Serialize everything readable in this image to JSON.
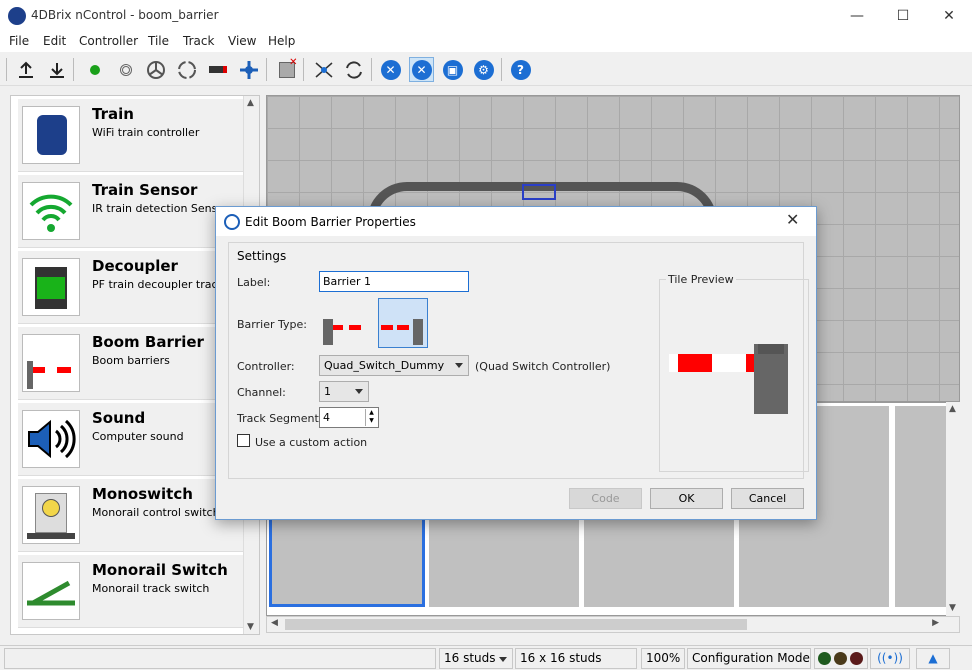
{
  "window": {
    "title": "4DBrix nControl - boom_barrier",
    "minimize": "—",
    "maximize": "☐",
    "close": "✕"
  },
  "menu": [
    "File",
    "Edit",
    "Controller",
    "Tile",
    "Track",
    "View",
    "Help"
  ],
  "toolbar": {
    "icons": [
      "upload-icon",
      "download-icon",
      "green-dot-icon",
      "sensor-icon",
      "switch-icon",
      "loop-icon",
      "decoupler-icon",
      "cross-icon",
      "delete-icon",
      "network-icon",
      "refresh-icon",
      "tools-icon",
      "tools-selected-icon",
      "camera-icon",
      "settings-icon",
      "help-icon"
    ]
  },
  "palette": {
    "items": [
      {
        "name": "Train",
        "desc": "WiFi train controller"
      },
      {
        "name": "Train Sensor",
        "desc": "IR train detection Sensor"
      },
      {
        "name": "Decoupler",
        "desc": "PF train decoupler track"
      },
      {
        "name": "Boom Barrier",
        "desc": "Boom barriers"
      },
      {
        "name": "Sound",
        "desc": "Computer sound"
      },
      {
        "name": "Monoswitch",
        "desc": "Monorail control switch"
      },
      {
        "name": "Monorail Switch",
        "desc": "Monorail track switch"
      }
    ]
  },
  "dialog": {
    "title": "Edit Boom Barrier Properties",
    "close": "✕",
    "settings_label": "Settings",
    "label_label": "Label:",
    "label_value": "Barrier 1",
    "barrier_type_label": "Barrier Type:",
    "controller_label": "Controller:",
    "controller_value": "Quad_Switch_Dummy",
    "controller_desc": "(Quad Switch Controller)",
    "channel_label": "Channel:",
    "channel_value": "1",
    "track_segment_label": "Track Segment:",
    "track_segment_value": "4",
    "custom_action_label": "Use a custom action",
    "custom_action_checked": false,
    "tile_preview_label": "Tile Preview",
    "code_button": "Code",
    "ok_button": "OK",
    "cancel_button": "Cancel"
  },
  "status": {
    "studs": "16 studs",
    "grid": "16 x 16 studs",
    "zoom": "100%",
    "mode": "Configuration Mode"
  },
  "colors": {
    "accent": "#1c6ed3",
    "barrier_red": "#ff0000",
    "selection": "#2a6fe0"
  }
}
